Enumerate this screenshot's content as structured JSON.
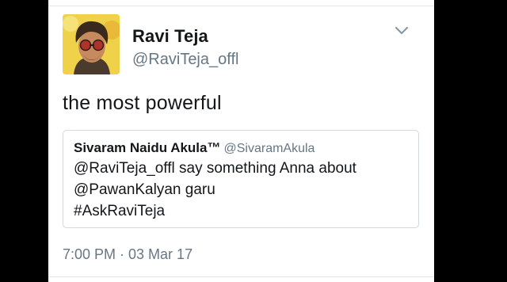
{
  "colors": {
    "background": "#000000",
    "card": "#ffffff",
    "text_primary": "#14171a",
    "text_secondary": "#657786",
    "border": "#cfd9de"
  },
  "tweet": {
    "author": {
      "display_name": "Ravi Teja",
      "username": "@RaviTeja_offl",
      "avatar_icon": "avatar-image"
    },
    "menu_icon": "chevron-down-icon",
    "text": "the most powerful",
    "quoted": {
      "display_name": "Sivaram Naidu Akula™",
      "username": "@SivaramAkula",
      "lines": [
        "@RaviTeja_offl say something Anna about",
        "@PawanKalyan garu",
        "#AskRaviTeja"
      ]
    },
    "timestamp": "7:00 PM · 03 Mar 17"
  }
}
